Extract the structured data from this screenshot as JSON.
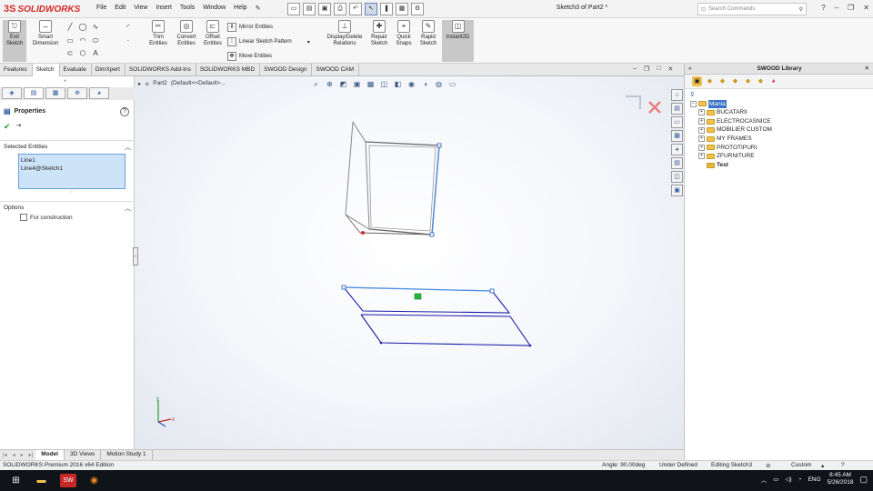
{
  "app": {
    "logo_mark": "3S",
    "logo_text": "SOLIDWORKS",
    "menu": [
      "File",
      "Edit",
      "View",
      "Insert",
      "Tools",
      "Window",
      "Help"
    ],
    "document_title": "Sketch3 of Part2 *",
    "search_placeholder": "Search Commands"
  },
  "commands": {
    "exit_sketch": "Exit Sketch",
    "smart_dimension": "Smart Dimension",
    "trim_entities": "Trim Entities",
    "convert_entities": "Convert Entities",
    "offset_entities": "Offset Entities",
    "mirror_entities": "Mirror Entities",
    "linear_sketch_pattern": "Linear Sketch Pattern",
    "move_entities": "Move Entities",
    "display_delete_relations": "Display/Delete Relations",
    "repair_sketch": "Repair Sketch",
    "quick_snaps": "Quick Snaps",
    "rapid_sketch": "Rapid Sketch",
    "instant2d": "Instant2D"
  },
  "tabs": [
    "Features",
    "Sketch",
    "Evaluate",
    "DimXpert",
    "SOLIDWORKS Add-Ins",
    "SOLIDWORKS MBD",
    "SWOOD Design",
    "SWOOD CAM"
  ],
  "active_tab": "Sketch",
  "property_manager": {
    "title": "Properties",
    "selected_entities_header": "Selected Entities",
    "selected_entities": [
      "Line1",
      "Line4@Sketch1"
    ],
    "options_header": "Options",
    "for_construction": "For construction"
  },
  "breadcrumb": {
    "part": "Part2",
    "config": "(Default<<Default>..."
  },
  "bottom_tabs": [
    "Model",
    "3D Views",
    "Motion Study 1"
  ],
  "status": {
    "edition": "SOLIDWORKS Premium 2016 x64 Edition",
    "angle": "Angle: 90.00deg",
    "state": "Under Defined",
    "editing": "Editing Sketch3",
    "units": "Custom"
  },
  "swood_library": {
    "title": "SWOOD Library",
    "root": "Mania",
    "items": [
      "BUCATARII",
      "ELECTROCASNICE",
      "MOBILIER CUSTOM",
      "MY FRAMES",
      "PROTOTIPURI",
      "ZFURNITURE"
    ],
    "test": "Test"
  },
  "axes": {
    "x": "x",
    "y": "y"
  },
  "taskbar": {
    "time": "8:45 AM",
    "date": "5/26/2018"
  },
  "colors": {
    "accent_blue": "#3b73c6",
    "sketch_dark_blue": "#1c1ca8",
    "sketch_light_blue": "#4a8be0",
    "logo_red": "#d62828"
  }
}
